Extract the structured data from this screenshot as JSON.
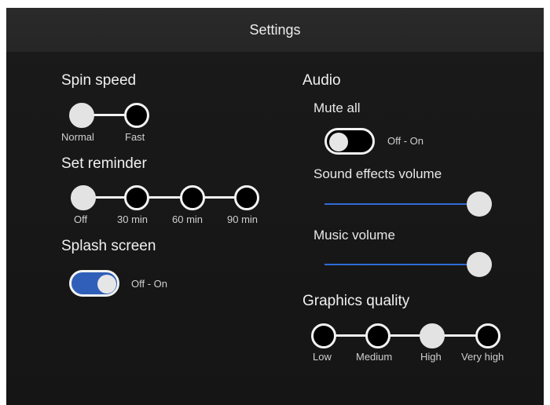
{
  "window": {
    "title": "Settings"
  },
  "spin_speed": {
    "label": "Spin speed",
    "options": [
      "Normal",
      "Fast"
    ],
    "selected": "Normal"
  },
  "set_reminder": {
    "label": "Set reminder",
    "options": [
      "Off",
      "30 min",
      "60 min",
      "90 min"
    ],
    "selected": "Off"
  },
  "splash_screen": {
    "label": "Splash screen",
    "toggle_caption": "Off - On",
    "state": "on"
  },
  "audio": {
    "label": "Audio",
    "mute_all": {
      "label": "Mute all",
      "toggle_caption": "Off - On",
      "state": "off"
    },
    "sound_effects_volume": {
      "label": "Sound effects volume",
      "value": 1.0
    },
    "music_volume": {
      "label": "Music volume",
      "value": 1.0
    }
  },
  "graphics_quality": {
    "label": "Graphics quality",
    "options": [
      "Low",
      "Medium",
      "High",
      "Very high"
    ],
    "selected": "High"
  },
  "colors": {
    "accent": "#2f6bd6",
    "background": "#181818",
    "titlebar": "#282828",
    "selected_node": "#e3e3e3"
  }
}
